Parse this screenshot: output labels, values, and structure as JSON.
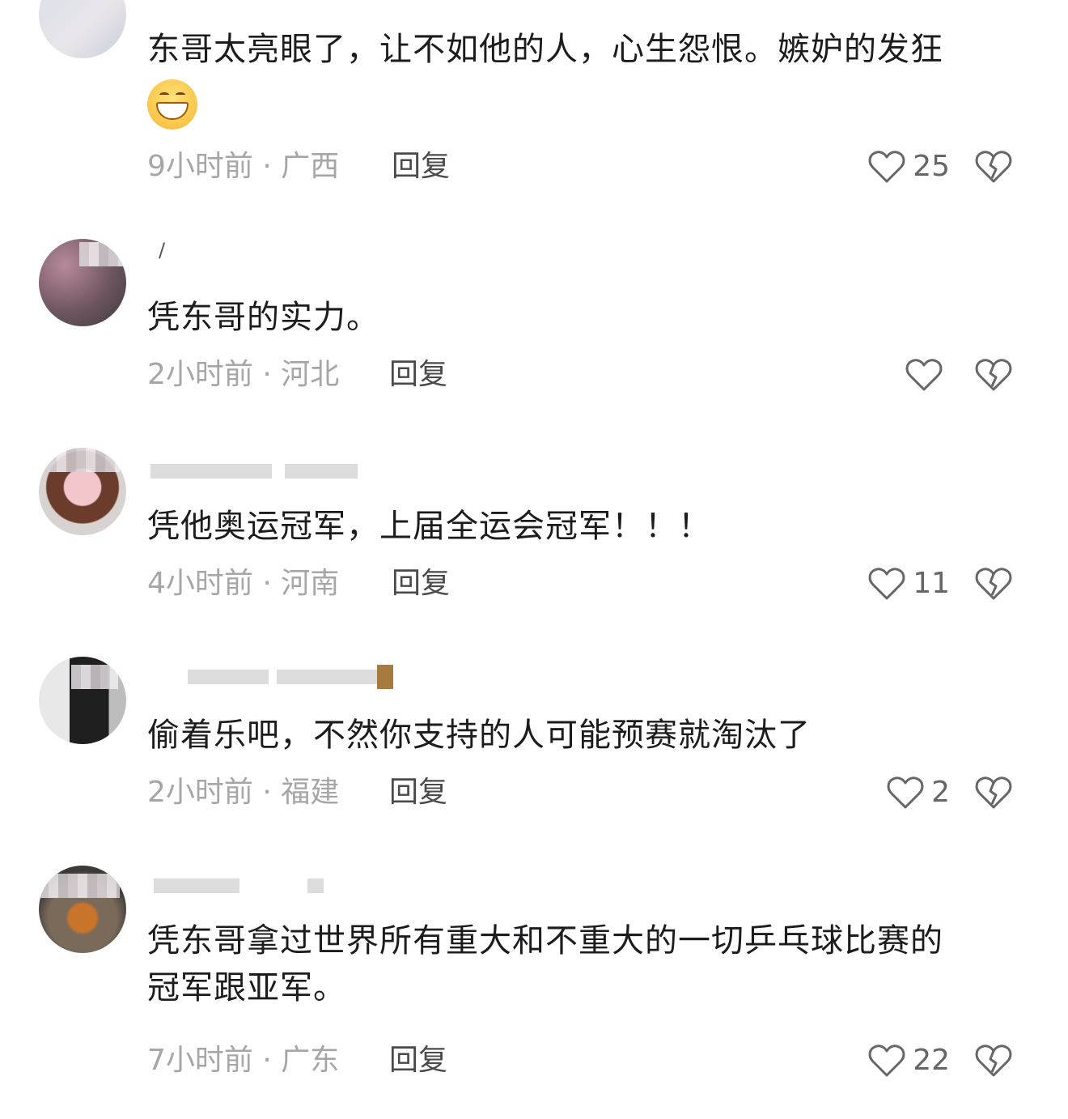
{
  "comments": [
    {
      "text": "东哥太亮眼了，让不如他的人，心生怨恨。嫉妒的发狂",
      "emoji": "grinning-face",
      "time_location": "9小时前 · 广西",
      "reply_label": "回复",
      "likes": "25"
    },
    {
      "username": "/",
      "text": "凭东哥的实力。",
      "time_location": "2小时前 · 河北",
      "reply_label": "回复",
      "likes": ""
    },
    {
      "text": "凭他奥运冠军，上届全运会冠军！！！",
      "time_location": "4小时前 · 河南",
      "reply_label": "回复",
      "likes": "11"
    },
    {
      "text": "偷着乐吧，不然你支持的人可能预赛就淘汰了",
      "time_location": "2小时前 · 福建",
      "reply_label": "回复",
      "likes": "2"
    },
    {
      "text_line1": "凭东哥拿过世界所有重大和不重大的一切乒乓球比赛的",
      "text_line2": "冠军跟亚军。",
      "time_location": "7小时前 · 广东",
      "reply_label": "回复",
      "likes": "22"
    }
  ],
  "icons": {
    "like": "heart-outline-icon",
    "dislike": "broken-heart-icon"
  },
  "colors": {
    "meta_gray": "#a6a6a6",
    "icon_gray": "#666666",
    "text": "#1c1c1e"
  }
}
